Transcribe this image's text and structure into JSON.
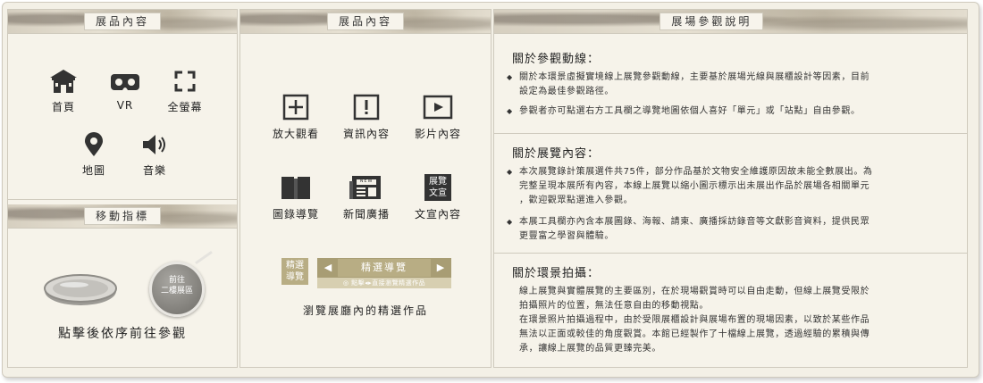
{
  "panel1": {
    "header": "展品內容",
    "icons": [
      {
        "label": "首頁",
        "icon": "temple-icon"
      },
      {
        "label": "VR",
        "icon": "vr-headset-icon"
      },
      {
        "label": "全螢幕",
        "icon": "fullscreen-icon"
      },
      {
        "label": "地圖",
        "icon": "map-pin-icon"
      },
      {
        "label": "音樂",
        "icon": "speaker-icon"
      }
    ],
    "move_header": "移動指標",
    "hotspot_label_line1": "前往",
    "hotspot_label_line2": "二樓展區",
    "move_caption": "點擊後依序前往參觀"
  },
  "panel2": {
    "header": "展品內容",
    "icons": [
      {
        "label": "放大觀看",
        "icon": "zoom-plus-icon"
      },
      {
        "label": "資訊內容",
        "icon": "info-exclamation-icon"
      },
      {
        "label": "影片內容",
        "icon": "video-play-icon"
      },
      {
        "label": "圖錄導覽",
        "icon": "catalog-book-icon"
      },
      {
        "label": "新聞廣播",
        "icon": "newspaper-icon"
      },
      {
        "label": "文宣內容",
        "icon": "promo-badge-icon"
      }
    ],
    "newspaper_tag": "NEW",
    "promo_badge_line1": "展覽",
    "promo_badge_line2": "文宣",
    "featured": {
      "badge_line1": "精選",
      "badge_line2": "導覽",
      "bar_title": "精選導覽",
      "hint": "◎ 點擊◂▸直接瀏覽精選作品"
    },
    "featured_caption": "瀏覽展廳內的精選作品"
  },
  "panel3": {
    "header": "展場參觀說明",
    "sections": [
      {
        "title": "關於參觀動線：",
        "bullets": [
          [
            "關於本環景虛擬實境線上展覽參觀動線，主要基於展場光線與展櫃設計等因素，目前",
            "設定為最佳參觀路徑。"
          ],
          [
            "參觀者亦可點選右方工具欄之導覽地圖依個人喜好「單元」或「站點」自由參觀。"
          ]
        ]
      },
      {
        "title": "關於展覽內容：",
        "bullets": [
          [
            "本次展覽錄計策展選件共75件，部分作品基於文物安全維護原因故未能全數展出。為",
            "完整呈現本展所有內容，本線上展覽以縮小圖示標示出未展出作品於展場各相關單元",
            "，歡迎觀眾點選進入參觀。"
          ],
          [
            "本展工具欄亦內含本展圖錄、海報、請柬、廣播採訪錄音等文獻影音資料，提供民眾",
            "更豐富之學習與體驗。"
          ]
        ]
      },
      {
        "title": "關於環景拍攝：",
        "paragraph": [
          "線上展覽與實體展覽的主要區別，在於現場觀賞時可以自由走動，但線上展覽受限於",
          "拍攝照片的位置，無法任意自由的移動視點。",
          "在環景照片拍攝過程中，由於受限展櫃設計與展場布置的現場因素，以致於某些作品",
          "無法以正面或較佳的角度觀賞。本館已經製作了十檔線上展覽，透過經驗的累積與傳",
          "承，讓線上展覽的品質更臻完美。"
        ]
      }
    ]
  },
  "colors": {
    "background": "#f6f3ea",
    "border": "#cfcabd",
    "icon": "#333333",
    "featured_gold": "#b8ad84"
  }
}
